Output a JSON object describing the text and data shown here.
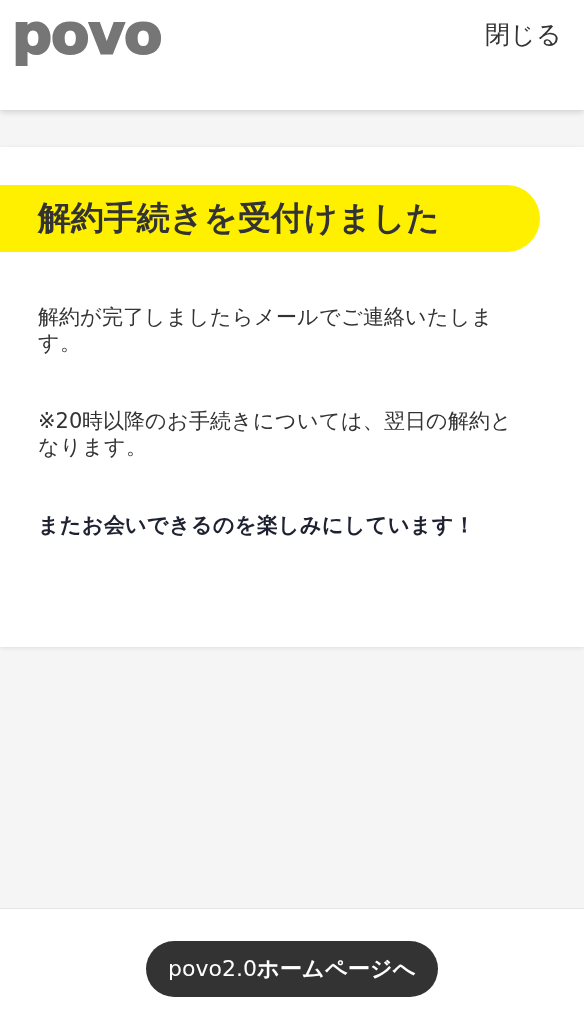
{
  "header": {
    "logo": "povo",
    "close": "閉じる"
  },
  "card": {
    "title": "解約手続きを受付けました",
    "paragraphs": [
      {
        "text": "解約が完了しましたらメールでご連絡いたします。",
        "bold": false
      },
      {
        "text": "※20時以降のお手続きについては、翌日の解約となります。",
        "bold": false
      },
      {
        "text": "またお会いできるのを楽しみにしています！",
        "bold": true
      }
    ]
  },
  "footer": {
    "button": "povo2.0**ホームページへ**"
  }
}
